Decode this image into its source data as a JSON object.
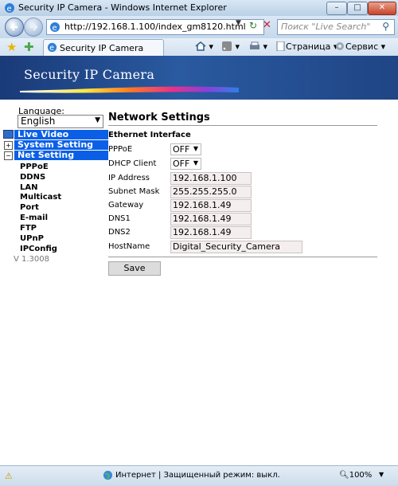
{
  "window": {
    "title": "Security IP Camera - Windows Internet Explorer"
  },
  "toolbar": {
    "url": "http://192.168.1.100/index_gm8120.html",
    "search_placeholder": "Поиск \"Live Search\"",
    "tab_title": "Security IP Camera",
    "page_menu": "Страница",
    "tools_menu": "Сервис"
  },
  "banner": {
    "brand": "Security IP Camera"
  },
  "sidebar": {
    "language_label": "Language:",
    "language_value": "English",
    "menus": [
      {
        "label": "Live Video",
        "state": "no-expander"
      },
      {
        "label": "System Setting",
        "state": "collapsed"
      },
      {
        "label": "Net Setting",
        "state": "expanded"
      }
    ],
    "net_items": [
      "PPPoE",
      "DDNS",
      "LAN",
      "Multicast",
      "Port",
      "E-mail",
      "FTP",
      "UPnP",
      "IPConfig"
    ],
    "version": "V 1.3008"
  },
  "main": {
    "title": "Network Settings",
    "section": "Ethernet Interface",
    "fields": {
      "pppoe": {
        "label": "PPPoE",
        "value": "OFF"
      },
      "dhcp": {
        "label": "DHCP Client",
        "value": "OFF"
      },
      "ip": {
        "label": "IP Address",
        "value": "192.168.1.100"
      },
      "mask": {
        "label": "Subnet Mask",
        "value": "255.255.255.0"
      },
      "gateway": {
        "label": "Gateway",
        "value": "192.168.1.49"
      },
      "dns1": {
        "label": "DNS1",
        "value": "192.168.1.49"
      },
      "dns2": {
        "label": "DNS2",
        "value": "192.168.1.49"
      },
      "hostname": {
        "label": "HostName",
        "value": "Digital_Security_Camera"
      }
    },
    "save_label": "Save"
  },
  "status": {
    "zone_text": "Интернет | Защищенный режим: выкл.",
    "zoom": "100%"
  },
  "colors": {
    "menu_blue": "#0a5fe6",
    "banner_blue": "#2a5aa0"
  },
  "icons": [
    "ie-icon",
    "back-arrow-icon",
    "forward-arrow-icon",
    "refresh-icon",
    "stop-icon",
    "search-icon",
    "favorites-star-icon",
    "add-favorite-icon",
    "home-icon",
    "rss-icon",
    "print-icon",
    "page-icon",
    "tools-gear-icon",
    "warning-icon",
    "globe-icon",
    "zoom-icon"
  ]
}
